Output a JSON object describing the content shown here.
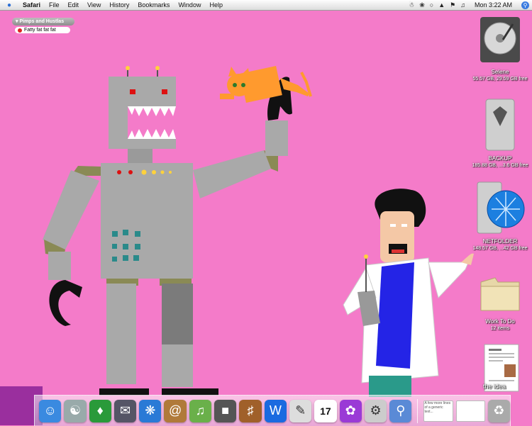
{
  "menubar": {
    "app": "Safari",
    "items": [
      "File",
      "Edit",
      "View",
      "History",
      "Bookmarks",
      "Window",
      "Help"
    ],
    "clock": "Mon 3:22 AM"
  },
  "widget": {
    "header": "Pimps and Hustlas",
    "item": "Fatty fat fat fat"
  },
  "desktop_icons": [
    {
      "label": "Selene",
      "sub": "55.57 GB, 29.59 GB free"
    },
    {
      "label": "BACKUP",
      "sub": "185.88 GB, ...3.6 GB free"
    },
    {
      "label": "NETFOLDER",
      "sub": "148.57 GB, ...42 GB free"
    },
    {
      "label": "Work To Do",
      "sub": "12 items"
    },
    {
      "label": "",
      "sub": ""
    }
  ],
  "dock": {
    "ical_day": "17",
    "minimized_label": "the idea",
    "doc_text": "A few more lines of a generic text..."
  },
  "colors": {
    "desktop": "#f47bc9",
    "robot_gray": "#a9a9a9",
    "robot_dark": "#7b7b7b",
    "joint": "#8a8a55"
  }
}
